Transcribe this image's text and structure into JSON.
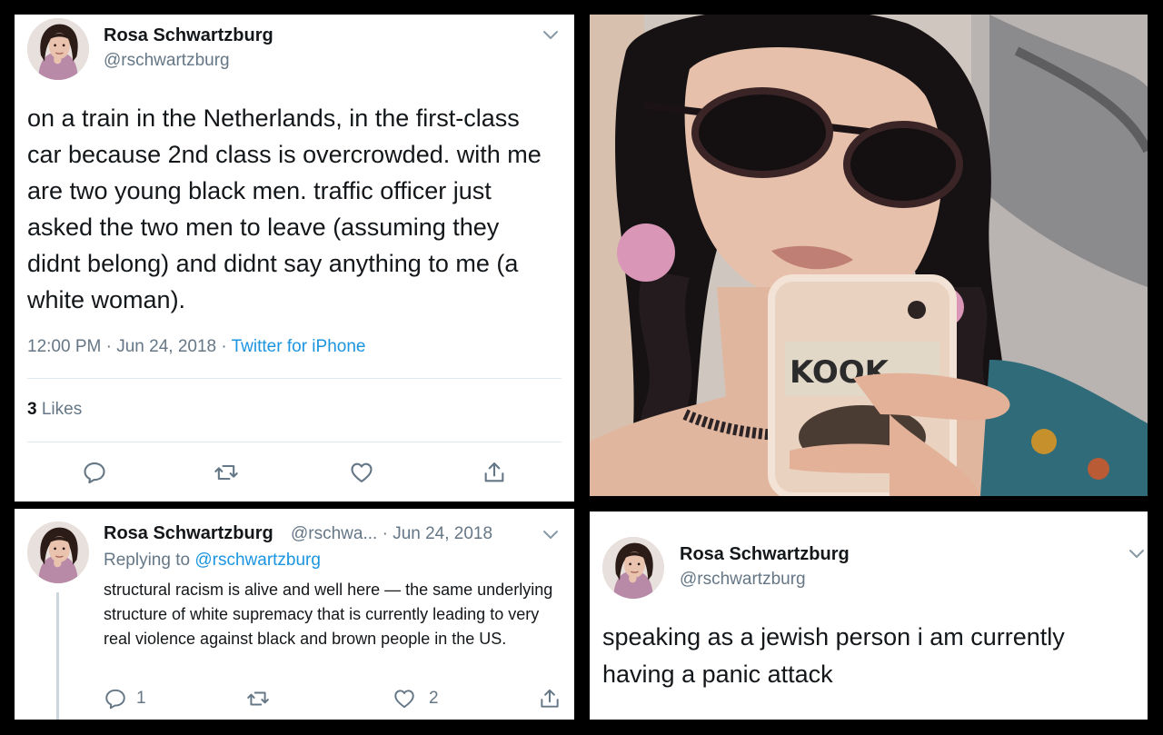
{
  "tweet_main": {
    "name": "Rosa Schwartzburg",
    "handle": "@rschwartzburg",
    "text": "on a train in the Netherlands, in the first-class car because 2nd class is overcrowded.  with me are two young black men.  traffic officer just asked the two men to leave (assuming they didnt belong) and didnt say anything to me (a white woman).",
    "time": "12:00 PM · Jun 24, 2018 · ",
    "source": "Twitter for iPhone",
    "likes_count": "3",
    "likes_label": "Likes"
  },
  "tweet_reply": {
    "name": "Rosa Schwartzburg",
    "handle_date": "@rschwa... · Jun 24, 2018",
    "replying_prefix": "Replying to ",
    "replying_to": "@rschwartzburg",
    "text": "structural racism is alive and well here — the same underlying structure of white supremacy that is currently leading to very real violence against black and brown people in the US.",
    "reply_count": "1",
    "like_count": "2"
  },
  "tweet_third": {
    "name": "Rosa Schwartzburg",
    "handle": "@rschwartzburg",
    "text": "speaking as a jewish person i am currently having a panic attack"
  },
  "colors": {
    "text": "#14171a",
    "muted": "#657786",
    "link": "#1b95e0",
    "divider": "#e1e8ed",
    "frame": "#000000"
  },
  "icons": [
    "chevron-down-icon",
    "reply-icon",
    "retweet-icon",
    "like-icon",
    "share-icon"
  ]
}
